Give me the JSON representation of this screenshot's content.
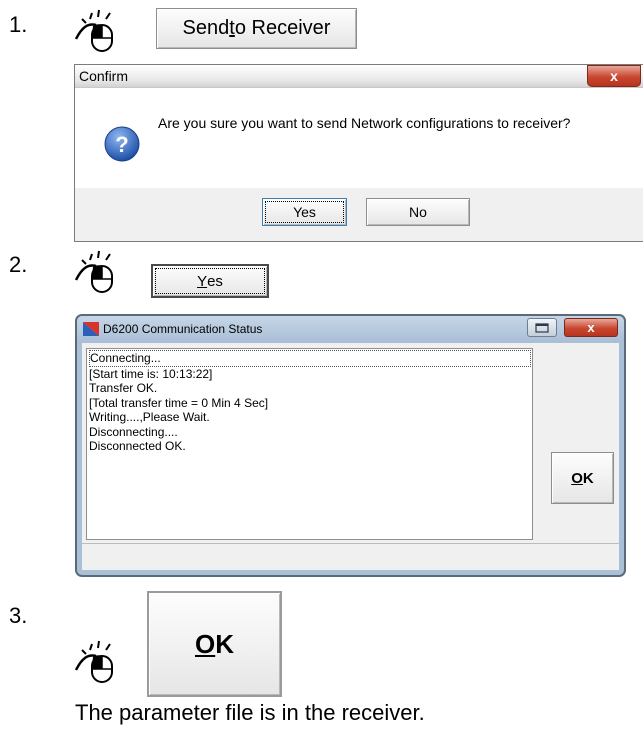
{
  "steps": [
    {
      "number": "1."
    },
    {
      "number": "2."
    },
    {
      "number": "3."
    }
  ],
  "step1": {
    "send_button_label_pre": "Send ",
    "send_button_label_mn": "t",
    "send_button_label_post": "o Receiver"
  },
  "confirm_dialog": {
    "title": "Confirm",
    "close_glyph": "x",
    "message": "Are you sure you want to send Network configurations to receiver?",
    "yes_label": "Yes",
    "no_label": "No"
  },
  "step2": {
    "yes_button_mn": "Y",
    "yes_button_rest": "es"
  },
  "status_window": {
    "title": "D6200 Communication Status",
    "close_glyph": "x",
    "log": [
      "Connecting...",
      "[Start time is: 10:13:22]",
      "Transfer OK.",
      "[Total transfer time = 0 Min 4 Sec]",
      "Writing....,Please Wait.",
      "Disconnecting....",
      "Disconnected OK."
    ],
    "ok_mn": "O",
    "ok_rest": "K"
  },
  "step3": {
    "ok_mn": "O",
    "ok_rest": "K"
  },
  "final_text": "The parameter file is in the receiver.",
  "icons": {
    "mouse": "mouse-left-click-icon",
    "question": "question-icon",
    "app": "app-icon"
  }
}
